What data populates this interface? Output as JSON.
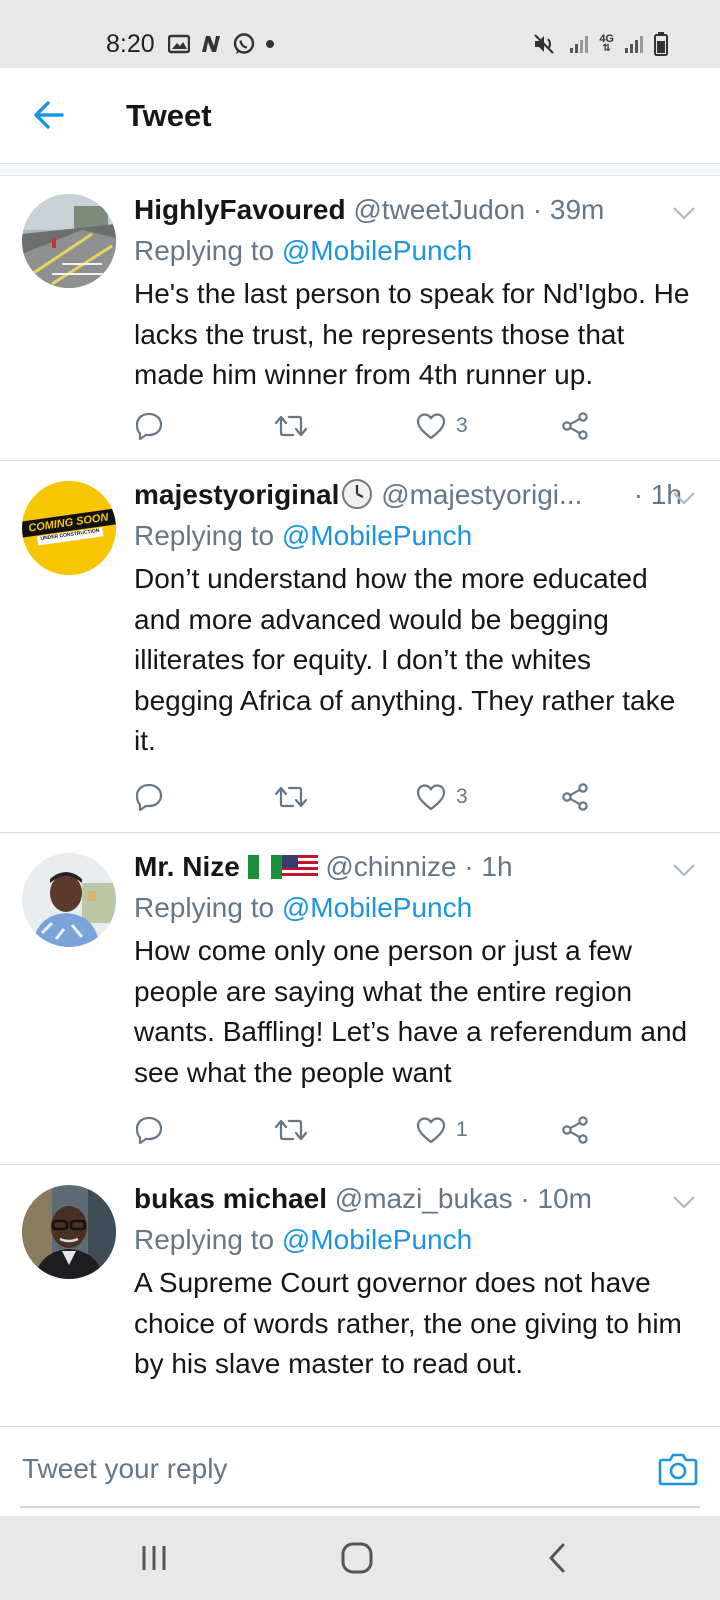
{
  "status_bar": {
    "time": "8:20",
    "left_icons": [
      "gallery-icon",
      "n-app-icon",
      "whatsapp-icon",
      "dot-icon"
    ],
    "right_icons": [
      "mute-icon",
      "signal-icon",
      "network-4g-icon",
      "signal-icon",
      "battery-icon"
    ],
    "network_label": "4G"
  },
  "header": {
    "title": "Tweet"
  },
  "tweets": [
    {
      "name": "HighlyFavoured",
      "handle": "@tweetJudon",
      "time": "· 39m",
      "replying_prefix": "Replying to ",
      "replying_to": "@MobilePunch",
      "text": "He's the last person to speak for Nd'Igbo. He lacks the trust, he represents those that made him winner from 4th runner up.",
      "likes": "3",
      "avatar": "road-photo"
    },
    {
      "name": "majestyoriginal",
      "name_emoji": "clock-emoji",
      "handle": "@majestyorigi...",
      "time": "· 1h",
      "replying_prefix": "Replying to ",
      "replying_to": "@MobilePunch",
      "text": "Don’t understand how the more educated and more advanced would be begging illiterates for equity. I don’t the whites begging Africa of anything. They rather take it.",
      "likes": "3",
      "avatar": "coming-soon-badge",
      "avatar_text": "COMING SOON",
      "avatar_subtext": "UNDER CONSTRUCTION"
    },
    {
      "name": "Mr. Nize",
      "name_emoji": "nigeria-flag, usa-flag",
      "handle": "@chinnize",
      "time": "· 1h",
      "replying_prefix": "Replying to ",
      "replying_to": "@MobilePunch",
      "text": "How come only one person or just a few people are saying what the entire region wants. Baffling! Let’s have a referendum and see what the people want",
      "likes": "1",
      "avatar": "person-photo"
    },
    {
      "name": "bukas michael",
      "handle": "@mazi_bukas",
      "time": "· 10m",
      "replying_prefix": "Replying to ",
      "replying_to": "@MobilePunch",
      "text": "A Supreme Court governor does not have choice of words rather, the one giving to him by his slave master to read out.",
      "avatar": "person-glasses-photo"
    }
  ],
  "composer": {
    "placeholder": "Tweet your reply"
  },
  "nav_bar": {
    "buttons": [
      "recents-icon",
      "home-icon",
      "back-icon"
    ]
  },
  "colors": {
    "accent": "#1b95e0",
    "text_primary": "#14171a",
    "text_secondary": "#657786",
    "divider": "#d9dde0",
    "system_bar": "#e8e8e8"
  }
}
